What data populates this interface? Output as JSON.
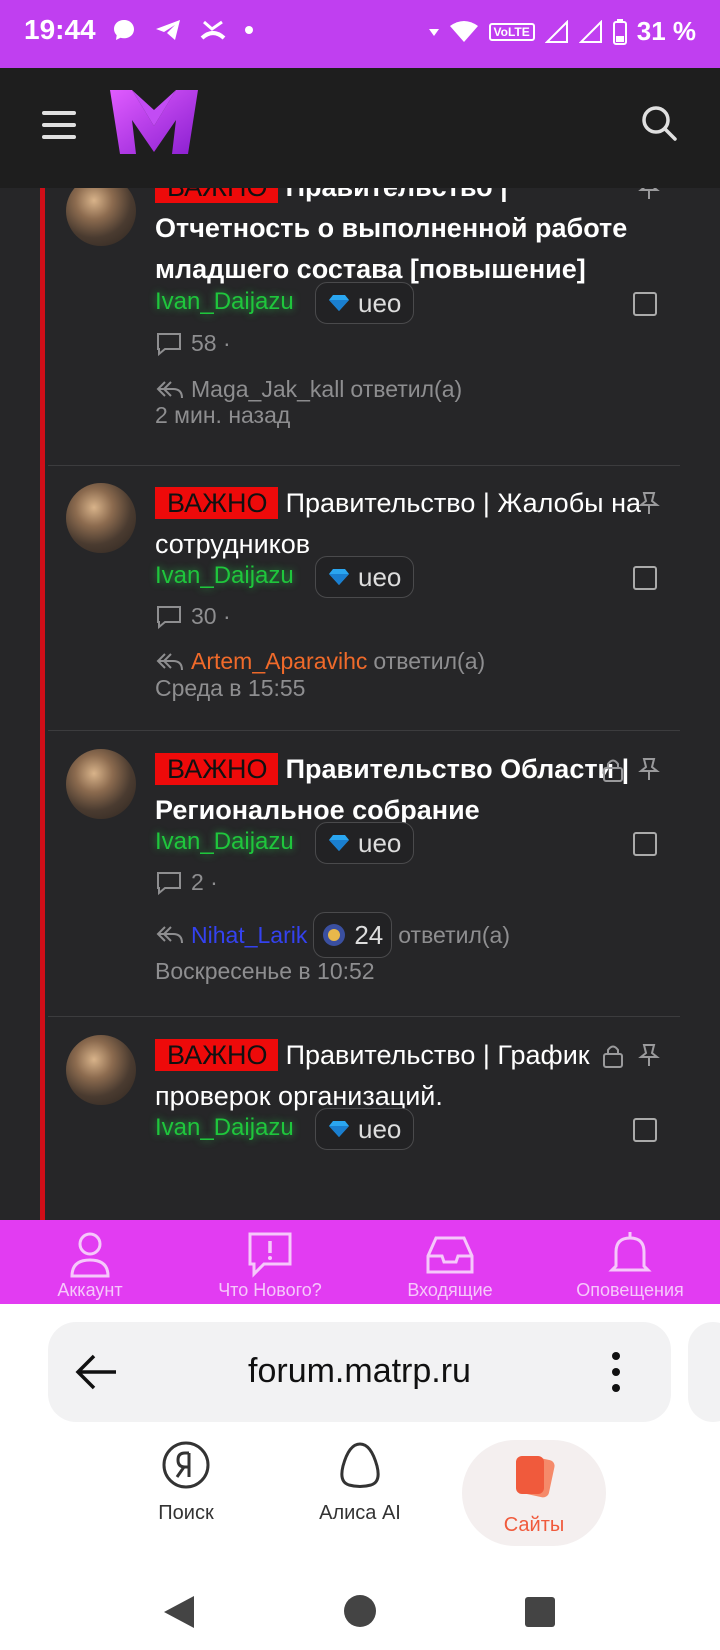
{
  "status_bar": {
    "time": "19:44",
    "network": "VoLTE",
    "battery": "31 %",
    "icons": [
      "chat-bubble-icon",
      "telegram-icon",
      "missed-call-icon",
      "wifi-icon",
      "signal-icon",
      "battery-icon"
    ]
  },
  "header": {
    "logo": "M",
    "menu_icon": "hamburger-icon",
    "search_icon": "search-icon"
  },
  "threads": [
    {
      "badge": "ВАЖНО",
      "title": "Правительство | Отчетность о выполненной работе младшего состава [повышение]",
      "author": "Ivan_Daijazu",
      "author_chip": "ueo",
      "replies": "58 ·",
      "last_poster": "Maga_Jak_kall",
      "replied_label": "ответил(а)",
      "last_time": "2 мин. назад",
      "locked": false
    },
    {
      "badge": "ВАЖНО",
      "title": "Правительство | Жалобы на сотрудников",
      "author": "Ivan_Daijazu",
      "author_chip": "ueo",
      "replies": "30 ·",
      "last_poster": "Artem_Aparavihc",
      "replied_label": "ответил(а)",
      "last_time": "Среда в 15:55",
      "locked": false
    },
    {
      "badge": "ВАЖНО",
      "title": "Правительство Области | Региональное собрание",
      "author": "Ivan_Daijazu",
      "author_chip": "ueo",
      "replies": "2 ·",
      "last_poster": "Nihat_Larik",
      "last_poster_chip": "24",
      "replied_label": "ответил(а)",
      "last_time": "Воскресенье в 10:52",
      "locked": true
    },
    {
      "badge": "ВАЖНО",
      "title": "Правительство | График проверок организаций.",
      "author": "Ivan_Daijazu",
      "author_chip": "ueo",
      "locked": true
    }
  ],
  "site_nav": [
    {
      "label": "Аккаунт",
      "icon": "user-icon"
    },
    {
      "label": "Что Нового?",
      "icon": "whats-new-icon"
    },
    {
      "label": "Входящие",
      "icon": "inbox-icon"
    },
    {
      "label": "Оповещения",
      "icon": "bell-icon"
    }
  ],
  "browser": {
    "url": "forum.matrp.ru",
    "tabs": [
      {
        "label": "Поиск",
        "icon": "yandex-search-icon"
      },
      {
        "label": "Алиса AI",
        "icon": "alice-icon"
      },
      {
        "label": "Сайты",
        "icon": "sites-icon",
        "active": true
      }
    ]
  },
  "colors": {
    "accent": "#c03ff0",
    "site_nav": "#e23cf2",
    "important_badge": "#ee0a0a",
    "author_green": "#1fc63c",
    "sites_orange": "#f05a3c"
  }
}
